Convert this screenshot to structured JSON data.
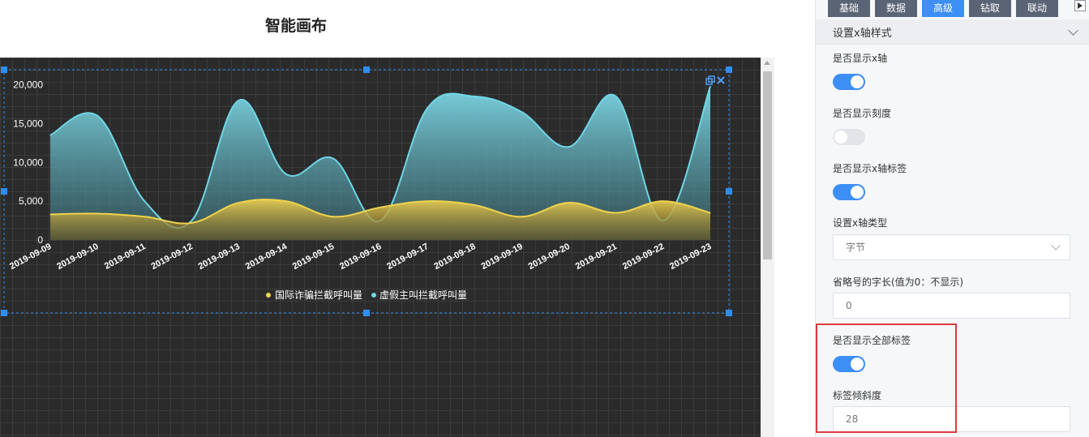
{
  "page_title": "智能画布",
  "chart_data": {
    "type": "area",
    "categories": [
      "2019-09-09",
      "2019-09-10",
      "2019-09-11",
      "2019-09-12",
      "2019-09-13",
      "2019-09-14",
      "2019-09-15",
      "2019-09-16",
      "2019-09-17",
      "2019-09-18",
      "2019-09-19",
      "2019-09-20",
      "2019-09-21",
      "2019-09-22",
      "2019-09-23"
    ],
    "series": [
      {
        "name": "国际诈骗拦截呼叫量",
        "color": "#f0d34d",
        "values": [
          3300,
          3400,
          3000,
          2200,
          4800,
          5000,
          3000,
          4200,
          5000,
          4500,
          3000,
          4800,
          3500,
          5000,
          3500
        ]
      },
      {
        "name": "虚假主叫拦截呼叫量",
        "color": "#6fd6e6",
        "values": [
          13500,
          16000,
          5000,
          2500,
          18000,
          8500,
          10500,
          2500,
          17000,
          18500,
          16500,
          12000,
          18500,
          2500,
          19800
        ]
      }
    ],
    "yticks": [
      "20,000",
      "15,000",
      "10,000",
      "5,000",
      "0"
    ],
    "ylim": [
      0,
      21000
    ],
    "x_label_rotation": 28,
    "legend_position": "bottom-center",
    "grid": false
  },
  "panel": {
    "tabs": [
      "基础",
      "数据",
      "高级",
      "钻取",
      "联动"
    ],
    "active_tab": "高级",
    "section_title": "设置x轴样式",
    "fields": {
      "show_x_axis": {
        "label": "是否显示x轴",
        "value": "on"
      },
      "show_ticks": {
        "label": "是否显示刻度",
        "value": "off"
      },
      "show_x_label": {
        "label": "是否显示x轴标签",
        "value": "on"
      },
      "x_axis_type": {
        "label": "设置x轴类型",
        "value": "字节"
      },
      "ellipsis_length": {
        "label": "省略号的字长(值为0：不显示)",
        "value": "0"
      },
      "show_all_labels": {
        "label": "是否显示全部标签",
        "value": "on"
      },
      "label_tilt": {
        "label": "标签倾斜度",
        "value": "28"
      }
    }
  },
  "colors": {
    "accent": "#3d8ef5",
    "highlight": "#e0393e",
    "canvas_bg": "#2b2b2b",
    "selection": "#2f8ef0"
  }
}
